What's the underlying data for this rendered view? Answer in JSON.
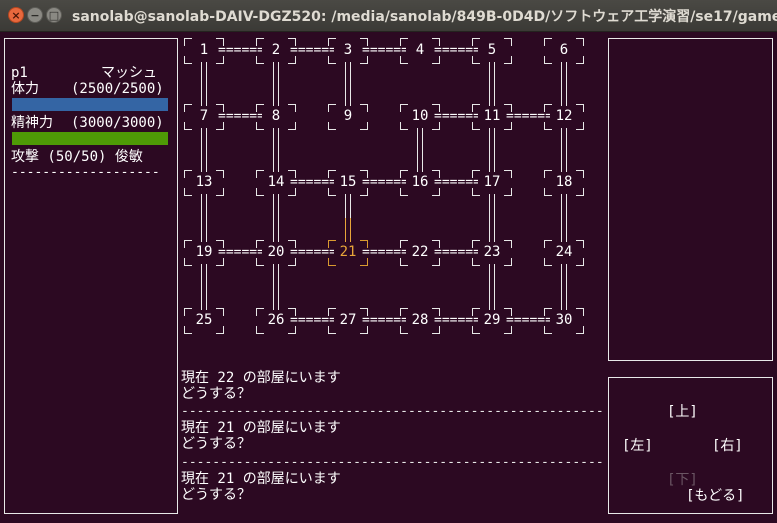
{
  "window": {
    "title": "sanolab@sanolab-DAIV-DGZ520: /media/sanolab/849B-0D4D/ソフトウェア工学演習/se17/game",
    "buttons": {
      "close": "×",
      "minimize": "−",
      "maximize": "□"
    }
  },
  "status": {
    "player_id": "p1",
    "player_name": "マッシュ",
    "hp_label": "体力",
    "hp_text": "(2500/2500)",
    "hp": {
      "current": 2500,
      "max": 2500,
      "color": "#3465a4"
    },
    "mp_label": "精神力",
    "mp_text": "(3000/3000)",
    "mp": {
      "current": 3000,
      "max": 3000,
      "color": "#4e9a06"
    },
    "attack_line": "攻撃 (50/50) 俊敏",
    "separator": "-------------------"
  },
  "map": {
    "current_room": "21",
    "line_color": "#e8e8e8",
    "highlight_color": "#e8a63a",
    "rows": [
      [
        "1",
        "2",
        "3",
        "4",
        "5",
        "6"
      ],
      [
        "7",
        "8",
        "9",
        "10",
        "11",
        "12"
      ],
      [
        "13",
        "14",
        "15",
        "16",
        "17",
        "18"
      ],
      [
        "19",
        "20",
        "21",
        "22",
        "23",
        "24"
      ],
      [
        "25",
        "26",
        "27",
        "28",
        "29",
        "30"
      ]
    ],
    "h_links": [
      {
        "row": 0,
        "after": 0,
        "text": "======"
      },
      {
        "row": 0,
        "after": 1,
        "text": "======"
      },
      {
        "row": 0,
        "after": 2,
        "text": "======"
      },
      {
        "row": 0,
        "after": 3,
        "text": "======"
      },
      {
        "row": 1,
        "after": 0,
        "text": "======"
      },
      {
        "row": 1,
        "after": 3,
        "text": "======"
      },
      {
        "row": 1,
        "after": 4,
        "text": "======"
      },
      {
        "row": 2,
        "after": 1,
        "text": "======"
      },
      {
        "row": 2,
        "after": 2,
        "text": "======"
      },
      {
        "row": 2,
        "after": 3,
        "text": "======"
      },
      {
        "row": 3,
        "after": 0,
        "text": "======"
      },
      {
        "row": 3,
        "after": 1,
        "text": "======"
      },
      {
        "row": 3,
        "after": 2,
        "text": "======"
      },
      {
        "row": 3,
        "after": 3,
        "text": "======"
      },
      {
        "row": 4,
        "after": 1,
        "text": "======"
      },
      {
        "row": 4,
        "after": 2,
        "text": "======"
      },
      {
        "row": 4,
        "after": 3,
        "text": "======"
      },
      {
        "row": 4,
        "after": 4,
        "text": "======"
      }
    ],
    "v_links": [
      {
        "row": 0,
        "col": 0
      },
      {
        "row": 0,
        "col": 1
      },
      {
        "row": 0,
        "col": 2
      },
      {
        "row": 0,
        "col": 4
      },
      {
        "row": 0,
        "col": 5
      },
      {
        "row": 1,
        "col": 0
      },
      {
        "row": 1,
        "col": 1
      },
      {
        "row": 1,
        "col": 3
      },
      {
        "row": 1,
        "col": 4
      },
      {
        "row": 1,
        "col": 5
      },
      {
        "row": 2,
        "col": 0
      },
      {
        "row": 2,
        "col": 1
      },
      {
        "row": 2,
        "col": 2
      },
      {
        "row": 2,
        "col": 4
      },
      {
        "row": 2,
        "col": 5
      },
      {
        "row": 3,
        "col": 0
      },
      {
        "row": 3,
        "col": 1
      },
      {
        "row": 3,
        "col": 4
      },
      {
        "row": 3,
        "col": 5
      }
    ]
  },
  "log": {
    "entries": [
      {
        "line1": "現在 22 の部屋にいます",
        "line2": "どうする？"
      },
      {
        "line1": "現在 21 の部屋にいます",
        "line2": "どうする？"
      },
      {
        "line1": "現在 21 の部屋にいます",
        "line2": "どうする？"
      }
    ],
    "separator": "------------------------------------------------------"
  },
  "controls": {
    "up": "[上]",
    "left": "[左]",
    "right": "[右]",
    "down": "[下]",
    "back": "[もどる]",
    "down_disabled": true
  }
}
